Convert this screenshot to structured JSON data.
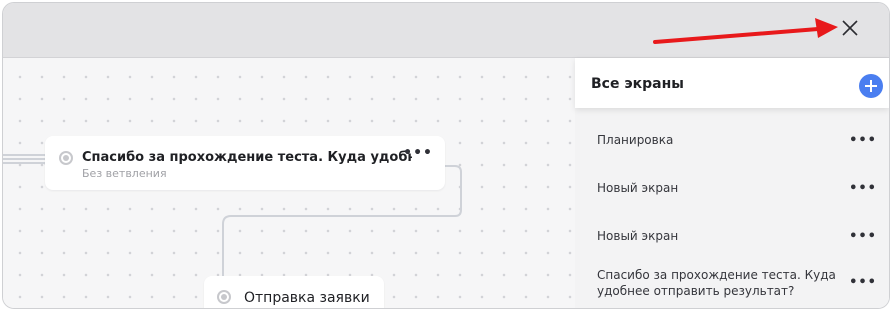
{
  "canvas": {
    "nodes": [
      {
        "title": "Спасибо за прохождение теста. Куда удобне...",
        "subtitle": "Без ветвления",
        "menu": "•••"
      },
      {
        "title": "Отправка заявки"
      }
    ]
  },
  "panel": {
    "title": "Все экраны",
    "items": [
      {
        "label": "Планировка",
        "menu": "•••"
      },
      {
        "label": "Новый экран",
        "menu": "•••"
      },
      {
        "label": "Новый экран",
        "menu": "•••"
      },
      {
        "label": "Спасибо за прохождение теста. Куда удобнее отправить результат?",
        "menu": "•••"
      }
    ]
  },
  "colors": {
    "accent": "#4a7ef0",
    "annotation_arrow": "#e8191b",
    "topbar": "#e3e3e5"
  },
  "icons": [
    "close-icon",
    "plus-icon",
    "more-dots-icon",
    "radio-icon"
  ]
}
